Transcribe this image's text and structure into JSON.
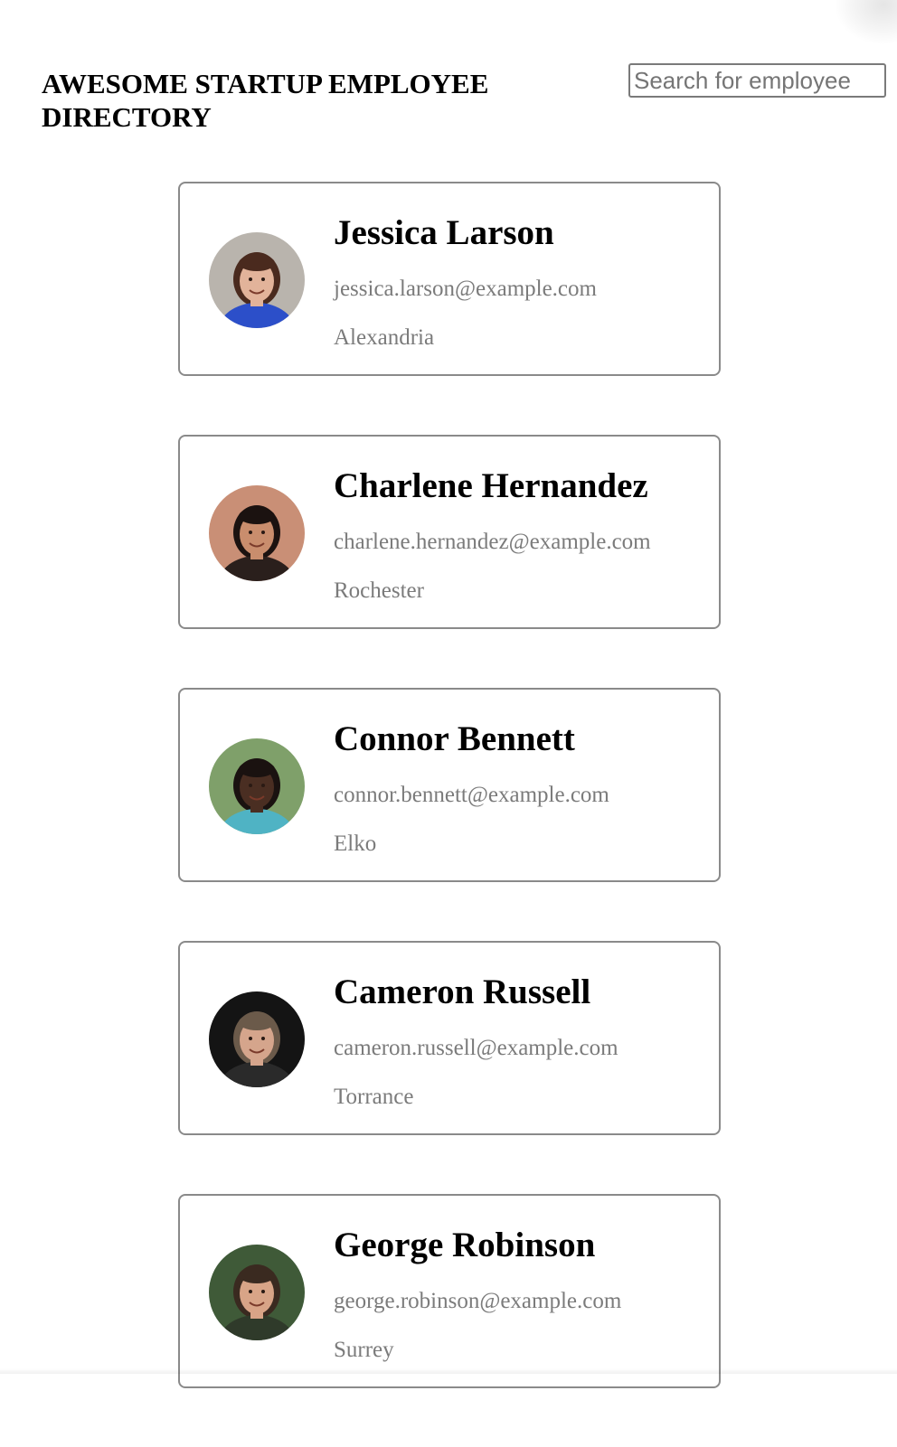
{
  "header": {
    "title": "AWESOME STARTUP EMPLOYEE DIRECTORY"
  },
  "search": {
    "placeholder": "Search for employee",
    "value": ""
  },
  "employees": [
    {
      "name": "Jessica Larson",
      "email": "jessica.larson@example.com",
      "city": "Alexandria",
      "avatar": {
        "icon": "avatar-photo",
        "bg": "#b9b4ad",
        "skin": "#e2b39a",
        "hair": "#4a2a1e",
        "shirt": "#2c4fc9"
      }
    },
    {
      "name": "Charlene Hernandez",
      "email": "charlene.hernandez@example.com",
      "city": "Rochester",
      "avatar": {
        "icon": "avatar-photo",
        "bg": "#c98f76",
        "skin": "#c98d6d",
        "hair": "#1b1210",
        "shirt": "#2a1f1c"
      }
    },
    {
      "name": "Connor Bennett",
      "email": "connor.bennett@example.com",
      "city": "Elko",
      "avatar": {
        "icon": "avatar-photo",
        "bg": "#7fa06a",
        "skin": "#4a2e22",
        "hair": "#1a1210",
        "shirt": "#4fb3c4"
      }
    },
    {
      "name": "Cameron Russell",
      "email": "cameron.russell@example.com",
      "city": "Torrance",
      "avatar": {
        "icon": "avatar-photo",
        "bg": "#141414",
        "skin": "#d5a58c",
        "hair": "#6b5a4a",
        "shirt": "#2a2a2a"
      }
    },
    {
      "name": "George Robinson",
      "email": "george.robinson@example.com",
      "city": "Surrey",
      "avatar": {
        "icon": "avatar-photo",
        "bg": "#3f5a38",
        "skin": "#d8a487",
        "hair": "#3a2a20",
        "shirt": "#2f3a2a"
      }
    }
  ]
}
